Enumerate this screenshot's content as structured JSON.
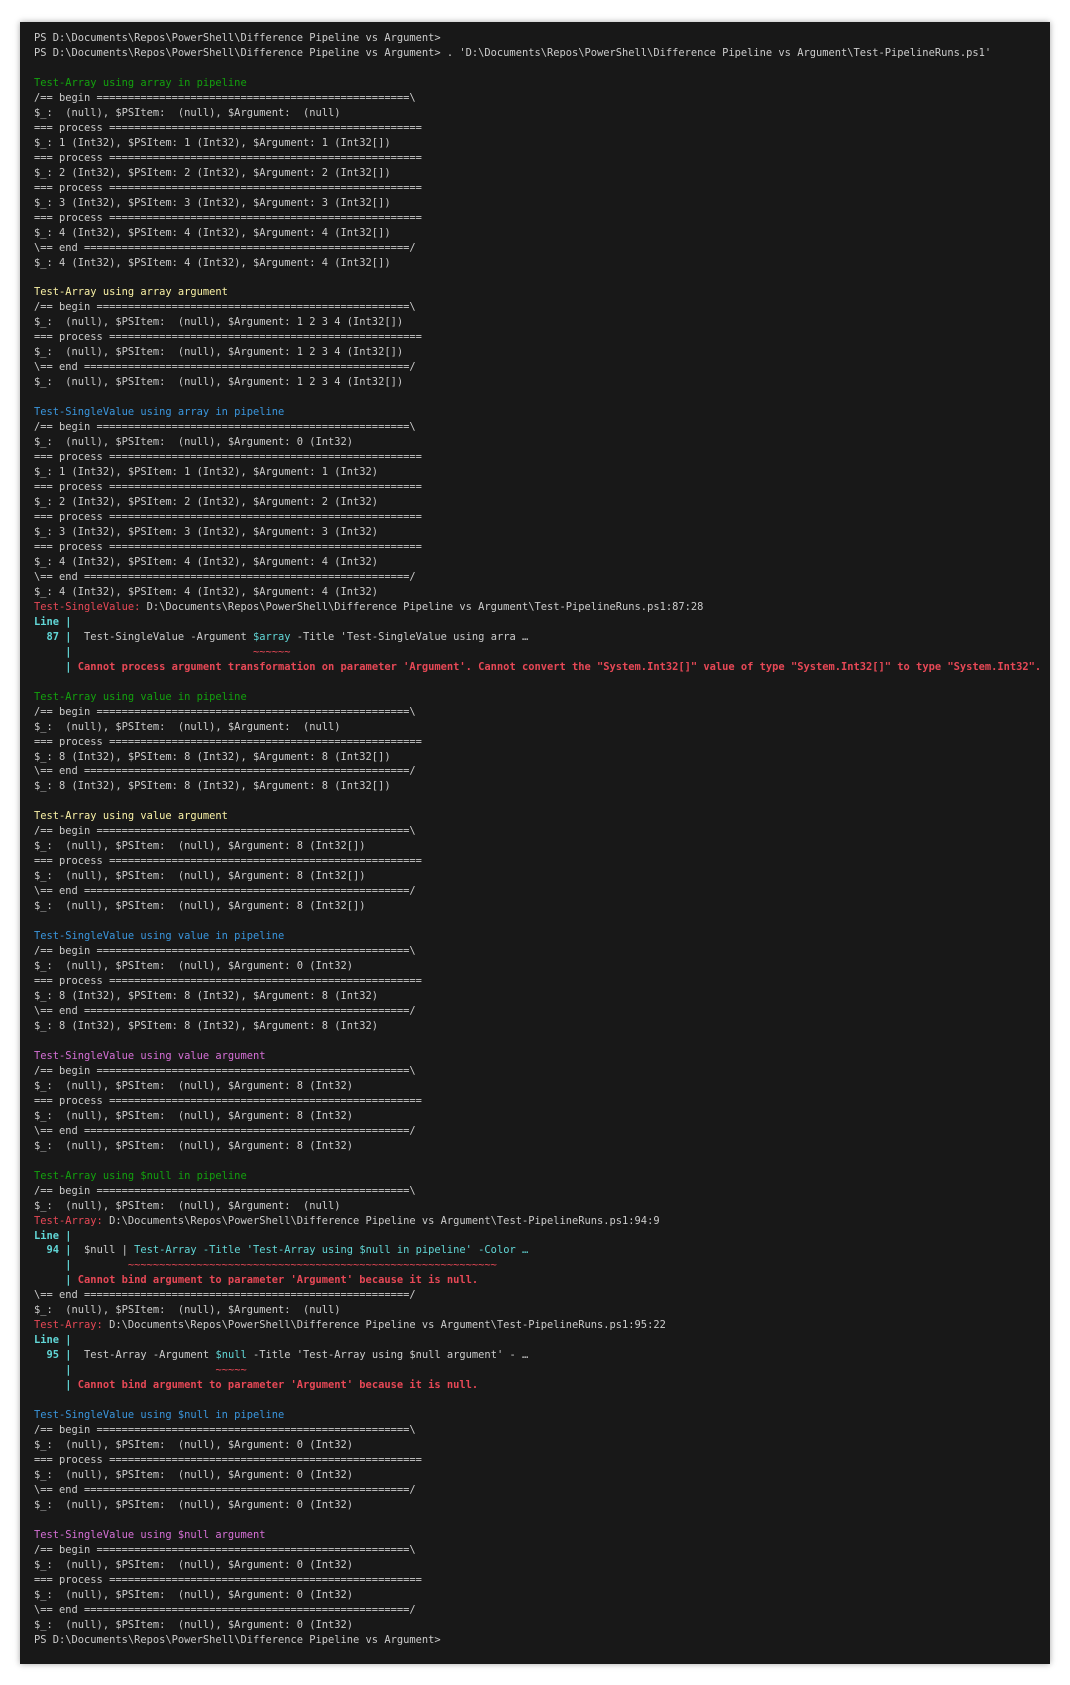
{
  "window": {
    "background": "#181818",
    "page_background": "#ffffff"
  },
  "colors": {
    "default": "#cccccc",
    "green": "#16c60c",
    "yellow": "#f9f1a5",
    "cyan": "#3a96dd",
    "magenta": "#b4009e",
    "red": "#e74856",
    "bright_cyan": "#61d6d6"
  },
  "lines": [
    [
      [
        "default",
        "PS D:\\Documents\\Repos\\PowerShell\\Difference Pipeline vs Argument>"
      ]
    ],
    [
      [
        "default",
        "PS D:\\Documents\\Repos\\PowerShell\\Difference Pipeline vs Argument> . 'D:\\Documents\\Repos\\PowerShell\\Difference Pipeline vs Argument\\Test-PipelineRuns.ps1'"
      ]
    ],
    [],
    [
      [
        "bgreen",
        "Test-Array using array in pipeline"
      ]
    ],
    [
      [
        "default",
        "/== begin ==================================================\\"
      ]
    ],
    [
      [
        "default",
        "$_:  (null), $PSItem:  (null), $Argument:  (null)"
      ]
    ],
    [
      [
        "default",
        "=== process =================================================="
      ]
    ],
    [
      [
        "default",
        "$_: 1 (Int32), $PSItem: 1 (Int32), $Argument: 1 (Int32[])"
      ]
    ],
    [
      [
        "default",
        "=== process =================================================="
      ]
    ],
    [
      [
        "default",
        "$_: 2 (Int32), $PSItem: 2 (Int32), $Argument: 2 (Int32[])"
      ]
    ],
    [
      [
        "default",
        "=== process =================================================="
      ]
    ],
    [
      [
        "default",
        "$_: 3 (Int32), $PSItem: 3 (Int32), $Argument: 3 (Int32[])"
      ]
    ],
    [
      [
        "default",
        "=== process =================================================="
      ]
    ],
    [
      [
        "default",
        "$_: 4 (Int32), $PSItem: 4 (Int32), $Argument: 4 (Int32[])"
      ]
    ],
    [
      [
        "default",
        "\\== end ====================================================/"
      ]
    ],
    [
      [
        "default",
        "$_: 4 (Int32), $PSItem: 4 (Int32), $Argument: 4 (Int32[])"
      ]
    ],
    [],
    [
      [
        "byellow",
        "Test-Array using array argument"
      ]
    ],
    [
      [
        "default",
        "/== begin ==================================================\\"
      ]
    ],
    [
      [
        "default",
        "$_:  (null), $PSItem:  (null), $Argument: 1 2 3 4 (Int32[])"
      ]
    ],
    [
      [
        "default",
        "=== process =================================================="
      ]
    ],
    [
      [
        "default",
        "$_:  (null), $PSItem:  (null), $Argument: 1 2 3 4 (Int32[])"
      ]
    ],
    [
      [
        "default",
        "\\== end ====================================================/"
      ]
    ],
    [
      [
        "default",
        "$_:  (null), $PSItem:  (null), $Argument: 1 2 3 4 (Int32[])"
      ]
    ],
    [],
    [
      [
        "cyan",
        "Test-SingleValue using array in pipeline"
      ]
    ],
    [
      [
        "default",
        "/== begin ==================================================\\"
      ]
    ],
    [
      [
        "default",
        "$_:  (null), $PSItem:  (null), $Argument: 0 (Int32)"
      ]
    ],
    [
      [
        "default",
        "=== process =================================================="
      ]
    ],
    [
      [
        "default",
        "$_: 1 (Int32), $PSItem: 1 (Int32), $Argument: 1 (Int32)"
      ]
    ],
    [
      [
        "default",
        "=== process =================================================="
      ]
    ],
    [
      [
        "default",
        "$_: 2 (Int32), $PSItem: 2 (Int32), $Argument: 2 (Int32)"
      ]
    ],
    [
      [
        "default",
        "=== process =================================================="
      ]
    ],
    [
      [
        "default",
        "$_: 3 (Int32), $PSItem: 3 (Int32), $Argument: 3 (Int32)"
      ]
    ],
    [
      [
        "default",
        "=== process =================================================="
      ]
    ],
    [
      [
        "default",
        "$_: 4 (Int32), $PSItem: 4 (Int32), $Argument: 4 (Int32)"
      ]
    ],
    [
      [
        "default",
        "\\== end ====================================================/"
      ]
    ],
    [
      [
        "default",
        "$_: 4 (Int32), $PSItem: 4 (Int32), $Argument: 4 (Int32)"
      ]
    ],
    [
      [
        "red",
        "Test-SingleValue: "
      ],
      [
        "default",
        "D:\\Documents\\Repos\\PowerShell\\Difference Pipeline vs Argument\\Test-PipelineRuns.ps1:87:28"
      ]
    ],
    [
      [
        "cyanb",
        "Line |"
      ]
    ],
    [
      [
        "cyanb",
        "  87 | "
      ],
      [
        "default",
        " Test-SingleValue -Argument "
      ],
      [
        "bcyan",
        "$array"
      ],
      [
        "default",
        " -Title 'Test-SingleValue using arra …"
      ]
    ],
    [
      [
        "cyanb",
        "     | "
      ],
      [
        "default",
        "                            "
      ],
      [
        "red",
        "~~~~~~"
      ]
    ],
    [
      [
        "cyanb",
        "     | "
      ],
      [
        "redb",
        "Cannot process argument transformation on parameter 'Argument'. Cannot convert the \"System.Int32[]\" value of type \"System.Int32[]\" to type \"System.Int32\"."
      ]
    ],
    [],
    [
      [
        "bgreen",
        "Test-Array using value in pipeline"
      ]
    ],
    [
      [
        "default",
        "/== begin ==================================================\\"
      ]
    ],
    [
      [
        "default",
        "$_:  (null), $PSItem:  (null), $Argument:  (null)"
      ]
    ],
    [
      [
        "default",
        "=== process =================================================="
      ]
    ],
    [
      [
        "default",
        "$_: 8 (Int32), $PSItem: 8 (Int32), $Argument: 8 (Int32[])"
      ]
    ],
    [
      [
        "default",
        "\\== end ====================================================/"
      ]
    ],
    [
      [
        "default",
        "$_: 8 (Int32), $PSItem: 8 (Int32), $Argument: 8 (Int32[])"
      ]
    ],
    [],
    [
      [
        "byellow",
        "Test-Array using value argument"
      ]
    ],
    [
      [
        "default",
        "/== begin ==================================================\\"
      ]
    ],
    [
      [
        "default",
        "$_:  (null), $PSItem:  (null), $Argument: 8 (Int32[])"
      ]
    ],
    [
      [
        "default",
        "=== process =================================================="
      ]
    ],
    [
      [
        "default",
        "$_:  (null), $PSItem:  (null), $Argument: 8 (Int32[])"
      ]
    ],
    [
      [
        "default",
        "\\== end ====================================================/"
      ]
    ],
    [
      [
        "default",
        "$_:  (null), $PSItem:  (null), $Argument: 8 (Int32[])"
      ]
    ],
    [],
    [
      [
        "cyan",
        "Test-SingleValue using value in pipeline"
      ]
    ],
    [
      [
        "default",
        "/== begin ==================================================\\"
      ]
    ],
    [
      [
        "default",
        "$_:  (null), $PSItem:  (null), $Argument: 0 (Int32)"
      ]
    ],
    [
      [
        "default",
        "=== process =================================================="
      ]
    ],
    [
      [
        "default",
        "$_: 8 (Int32), $PSItem: 8 (Int32), $Argument: 8 (Int32)"
      ]
    ],
    [
      [
        "default",
        "\\== end ====================================================/"
      ]
    ],
    [
      [
        "default",
        "$_: 8 (Int32), $PSItem: 8 (Int32), $Argument: 8 (Int32)"
      ]
    ],
    [],
    [
      [
        "bmagenta",
        "Test-SingleValue using value argument"
      ]
    ],
    [
      [
        "default",
        "/== begin ==================================================\\"
      ]
    ],
    [
      [
        "default",
        "$_:  (null), $PSItem:  (null), $Argument: 8 (Int32)"
      ]
    ],
    [
      [
        "default",
        "=== process =================================================="
      ]
    ],
    [
      [
        "default",
        "$_:  (null), $PSItem:  (null), $Argument: 8 (Int32)"
      ]
    ],
    [
      [
        "default",
        "\\== end ====================================================/"
      ]
    ],
    [
      [
        "default",
        "$_:  (null), $PSItem:  (null), $Argument: 8 (Int32)"
      ]
    ],
    [],
    [
      [
        "bgreen",
        "Test-Array using $null in pipeline"
      ]
    ],
    [
      [
        "default",
        "/== begin ==================================================\\"
      ]
    ],
    [
      [
        "default",
        "$_:  (null), $PSItem:  (null), $Argument:  (null)"
      ]
    ],
    [
      [
        "red",
        "Test-Array: "
      ],
      [
        "default",
        "D:\\Documents\\Repos\\PowerShell\\Difference Pipeline vs Argument\\Test-PipelineRuns.ps1:94:9"
      ]
    ],
    [
      [
        "cyanb",
        "Line |"
      ]
    ],
    [
      [
        "cyanb",
        "  94 | "
      ],
      [
        "default",
        " $null | "
      ],
      [
        "bcyan",
        "Test-Array -Title 'Test-Array using $null in pipeline' -Color …"
      ]
    ],
    [
      [
        "cyanb",
        "     | "
      ],
      [
        "default",
        "        "
      ],
      [
        "red",
        "~~~~~~~~~~~~~~~~~~~~~~~~~~~~~~~~~~~~~~~~~~~~~~~~~~~~~~~~~~~"
      ]
    ],
    [
      [
        "cyanb",
        "     | "
      ],
      [
        "redb",
        "Cannot bind argument to parameter 'Argument' because it is null."
      ]
    ],
    [
      [
        "default",
        "\\== end ====================================================/"
      ]
    ],
    [
      [
        "default",
        "$_:  (null), $PSItem:  (null), $Argument:  (null)"
      ]
    ],
    [
      [
        "red",
        "Test-Array: "
      ],
      [
        "default",
        "D:\\Documents\\Repos\\PowerShell\\Difference Pipeline vs Argument\\Test-PipelineRuns.ps1:95:22"
      ]
    ],
    [
      [
        "cyanb",
        "Line |"
      ]
    ],
    [
      [
        "cyanb",
        "  95 | "
      ],
      [
        "default",
        " Test-Array -Argument "
      ],
      [
        "bcyan",
        "$null"
      ],
      [
        "default",
        " -Title 'Test-Array using $null argument' - …"
      ]
    ],
    [
      [
        "cyanb",
        "     | "
      ],
      [
        "default",
        "                      "
      ],
      [
        "red",
        "~~~~~"
      ]
    ],
    [
      [
        "cyanb",
        "     | "
      ],
      [
        "redb",
        "Cannot bind argument to parameter 'Argument' because it is null."
      ]
    ],
    [],
    [
      [
        "cyan",
        "Test-SingleValue using $null in pipeline"
      ]
    ],
    [
      [
        "default",
        "/== begin ==================================================\\"
      ]
    ],
    [
      [
        "default",
        "$_:  (null), $PSItem:  (null), $Argument: 0 (Int32)"
      ]
    ],
    [
      [
        "default",
        "=== process =================================================="
      ]
    ],
    [
      [
        "default",
        "$_:  (null), $PSItem:  (null), $Argument: 0 (Int32)"
      ]
    ],
    [
      [
        "default",
        "\\== end ====================================================/"
      ]
    ],
    [
      [
        "default",
        "$_:  (null), $PSItem:  (null), $Argument: 0 (Int32)"
      ]
    ],
    [],
    [
      [
        "bmagenta",
        "Test-SingleValue using $null argument"
      ]
    ],
    [
      [
        "default",
        "/== begin ==================================================\\"
      ]
    ],
    [
      [
        "default",
        "$_:  (null), $PSItem:  (null), $Argument: 0 (Int32)"
      ]
    ],
    [
      [
        "default",
        "=== process =================================================="
      ]
    ],
    [
      [
        "default",
        "$_:  (null), $PSItem:  (null), $Argument: 0 (Int32)"
      ]
    ],
    [
      [
        "default",
        "\\== end ====================================================/"
      ]
    ],
    [
      [
        "default",
        "$_:  (null), $PSItem:  (null), $Argument: 0 (Int32)"
      ]
    ],
    [
      [
        "default",
        "PS D:\\Documents\\Repos\\PowerShell\\Difference Pipeline vs Argument>"
      ]
    ]
  ]
}
